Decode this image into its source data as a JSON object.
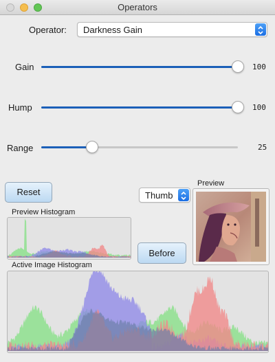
{
  "window": {
    "title": "Operators"
  },
  "operator": {
    "label": "Operator:",
    "selected": "Darkness Gain"
  },
  "sliders": [
    {
      "label": "Gain",
      "value": "100",
      "fraction": 1.0
    },
    {
      "label": "Hump",
      "value": "100",
      "fraction": 1.0
    },
    {
      "label": "Range",
      "value": "25",
      "fraction": 0.26
    }
  ],
  "buttons": {
    "reset": "Reset",
    "before": "Before"
  },
  "preview": {
    "label": "Preview",
    "mode_selected": "Thumb"
  },
  "histograms": {
    "preview_label": "Preview Histogram",
    "active_label": "Active Image Histogram"
  },
  "colors": {
    "slider_fill": "#1b5fb8",
    "hist_red": "#f08a8a",
    "hist_green": "#8ee08e",
    "hist_blue": "#8c86e8",
    "hist_overlap": "#6c7fa8"
  }
}
